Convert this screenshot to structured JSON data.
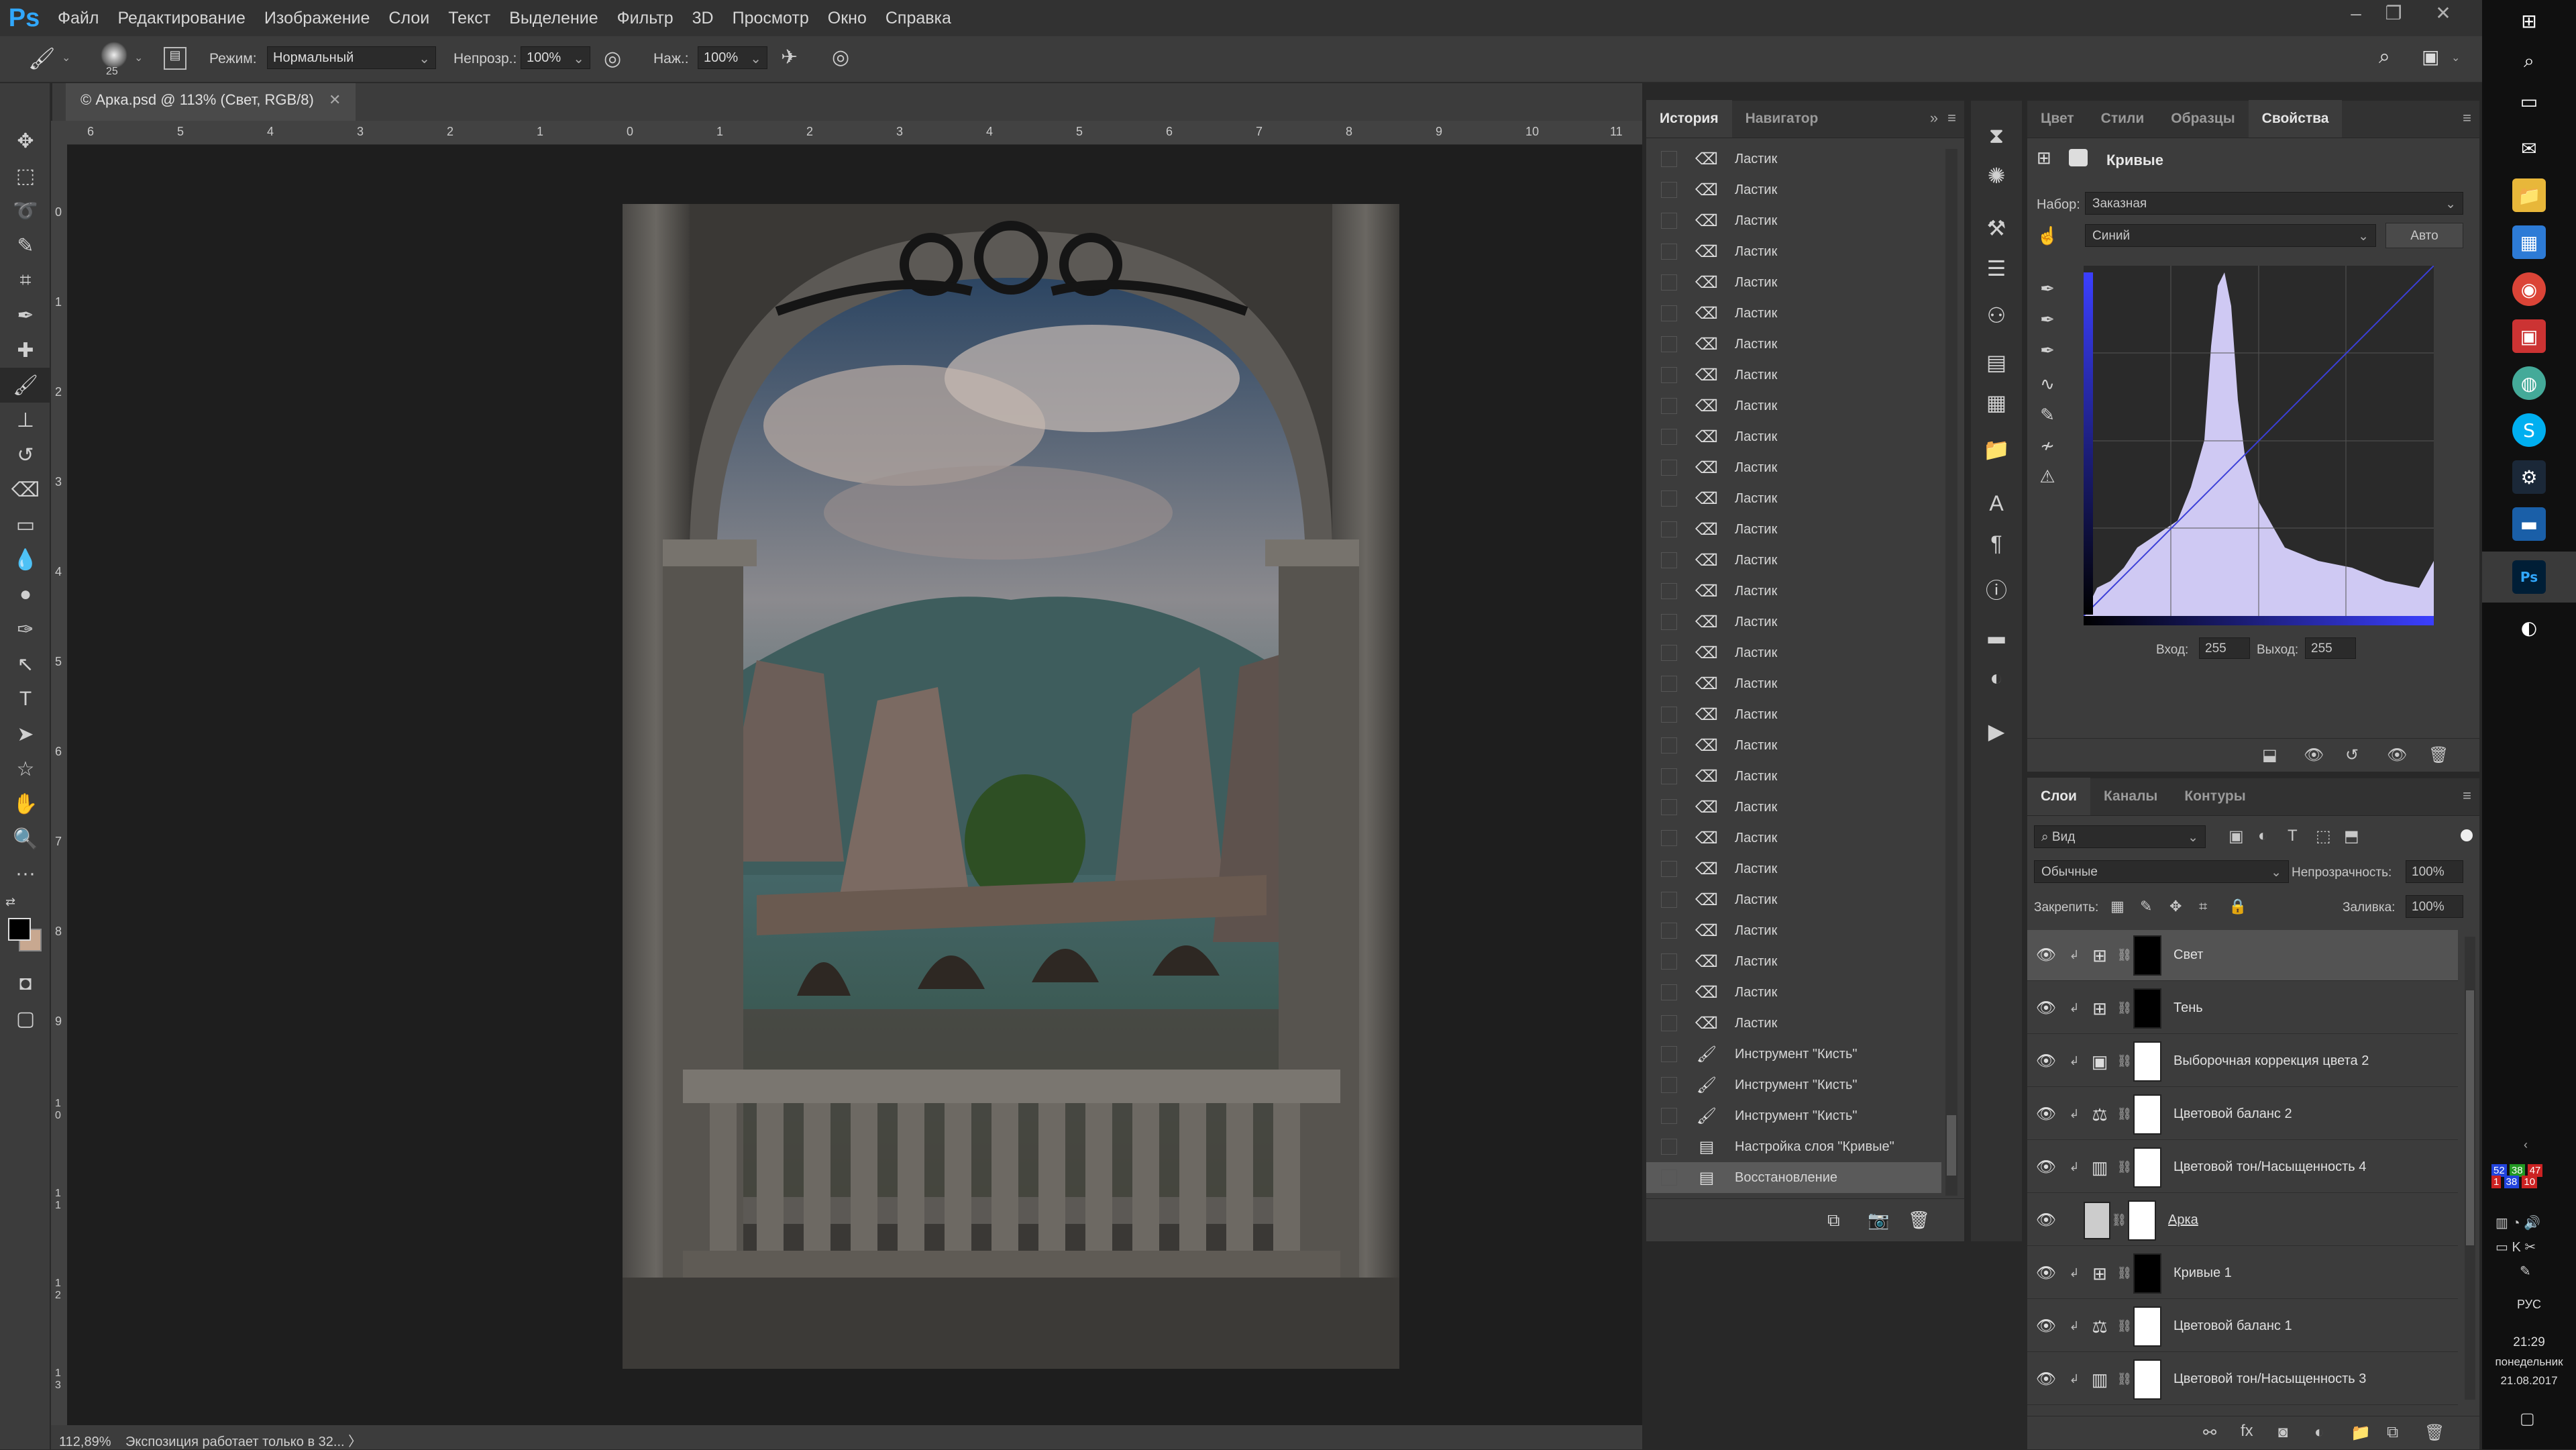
{
  "app": {
    "logo": "Ps"
  },
  "menu": [
    "Файл",
    "Редактирование",
    "Изображение",
    "Слои",
    "Текст",
    "Выделение",
    "Фильтр",
    "3D",
    "Просмотр",
    "Окно",
    "Справка"
  ],
  "options": {
    "brush_size": "25",
    "mode_label": "Режим:",
    "mode_value": "Нормальный",
    "opacity_label": "Непрозр.:",
    "opacity_value": "100%",
    "pressure_label": "Наж.:",
    "pressure_value": "100%"
  },
  "document": {
    "tab_title": "© Арка.psd @ 113% (Свет, RGB/8)"
  },
  "ruler_h": [
    "6",
    "5",
    "4",
    "3",
    "2",
    "1",
    "0",
    "1",
    "2",
    "3",
    "4",
    "5",
    "6",
    "7",
    "8",
    "9",
    "10",
    "11"
  ],
  "ruler_v": [
    "0",
    "1",
    "2",
    "3",
    "4",
    "5",
    "6",
    "7",
    "8",
    "9",
    "1 0",
    "1 1",
    "1 2",
    "1 3"
  ],
  "status": {
    "zoom": "112,89%",
    "message": "Экспозиция работает только в 32... 〉"
  },
  "history": {
    "tabs": [
      "История",
      "Навигатор"
    ],
    "items": [
      "Ластик",
      "Ластик",
      "Ластик",
      "Ластик",
      "Ластик",
      "Ластик",
      "Ластик",
      "Ластик",
      "Ластик",
      "Ластик",
      "Ластик",
      "Ластик",
      "Ластик",
      "Ластик",
      "Ластик",
      "Ластик",
      "Ластик",
      "Ластик",
      "Ластик",
      "Ластик",
      "Ластик",
      "Ластик",
      "Ластик",
      "Ластик",
      "Ластик",
      "Ластик",
      "Ластик",
      "Ластик",
      "Ластик",
      "Инструмент \"Кисть\"",
      "Инструмент \"Кисть\"",
      "Инструмент \"Кисть\"",
      "Настройка слоя \"Кривые\"",
      "Восстановление"
    ]
  },
  "properties": {
    "tabs": [
      "Цвет",
      "Стили",
      "Образцы",
      "Свойства"
    ],
    "title": "Кривые",
    "preset_label": "Набор:",
    "preset_value": "Заказная",
    "channel_value": "Синий",
    "auto_button": "Авто",
    "input_label": "Вход:",
    "input_value": "255",
    "output_label": "Выход:",
    "output_value": "255"
  },
  "layers": {
    "tabs": [
      "Слои",
      "Каналы",
      "Контуры"
    ],
    "filter_kind": "Вид",
    "blend_mode": "Обычные",
    "opacity_label": "Непрозрачность:",
    "opacity_value": "100%",
    "lock_label": "Закрепить:",
    "fill_label": "Заливка:",
    "fill_value": "100%",
    "items": [
      {
        "name": "Свет",
        "icon": "curves-icon",
        "mask": "black",
        "selected": true
      },
      {
        "name": "Тень",
        "icon": "curves-icon",
        "mask": "black",
        "selected": false
      },
      {
        "name": "Выборочная коррекция цвета 2",
        "icon": "selective-color-icon",
        "mask": "white",
        "selected": false
      },
      {
        "name": "Цветовой баланс 2",
        "icon": "color-balance-icon",
        "mask": "white",
        "selected": false
      },
      {
        "name": "Цветовой тон/Насыщенность 4",
        "icon": "hue-saturation-icon",
        "mask": "white",
        "selected": false
      },
      {
        "name": "Арка",
        "icon": "pixel-layer-icon",
        "mask": "white",
        "selected": false
      },
      {
        "name": "Кривые 1",
        "icon": "curves-icon",
        "mask": "black",
        "selected": false
      },
      {
        "name": "Цветовой баланс 1",
        "icon": "color-balance-icon",
        "mask": "white",
        "selected": false
      },
      {
        "name": "Цветовой тон/Насыщенность 3",
        "icon": "hue-saturation-icon",
        "mask": "white",
        "selected": false
      }
    ]
  },
  "taskbar": {
    "time": "21:29",
    "day": "понедельник",
    "date": "21.08.2017",
    "lang": "РУС",
    "tray_numbers": [
      "52",
      "38",
      "47",
      "1",
      "38",
      "10"
    ]
  },
  "colors": {
    "accent": "#31a8ff",
    "panel": "#3c3c3c",
    "dark": "#282828"
  }
}
